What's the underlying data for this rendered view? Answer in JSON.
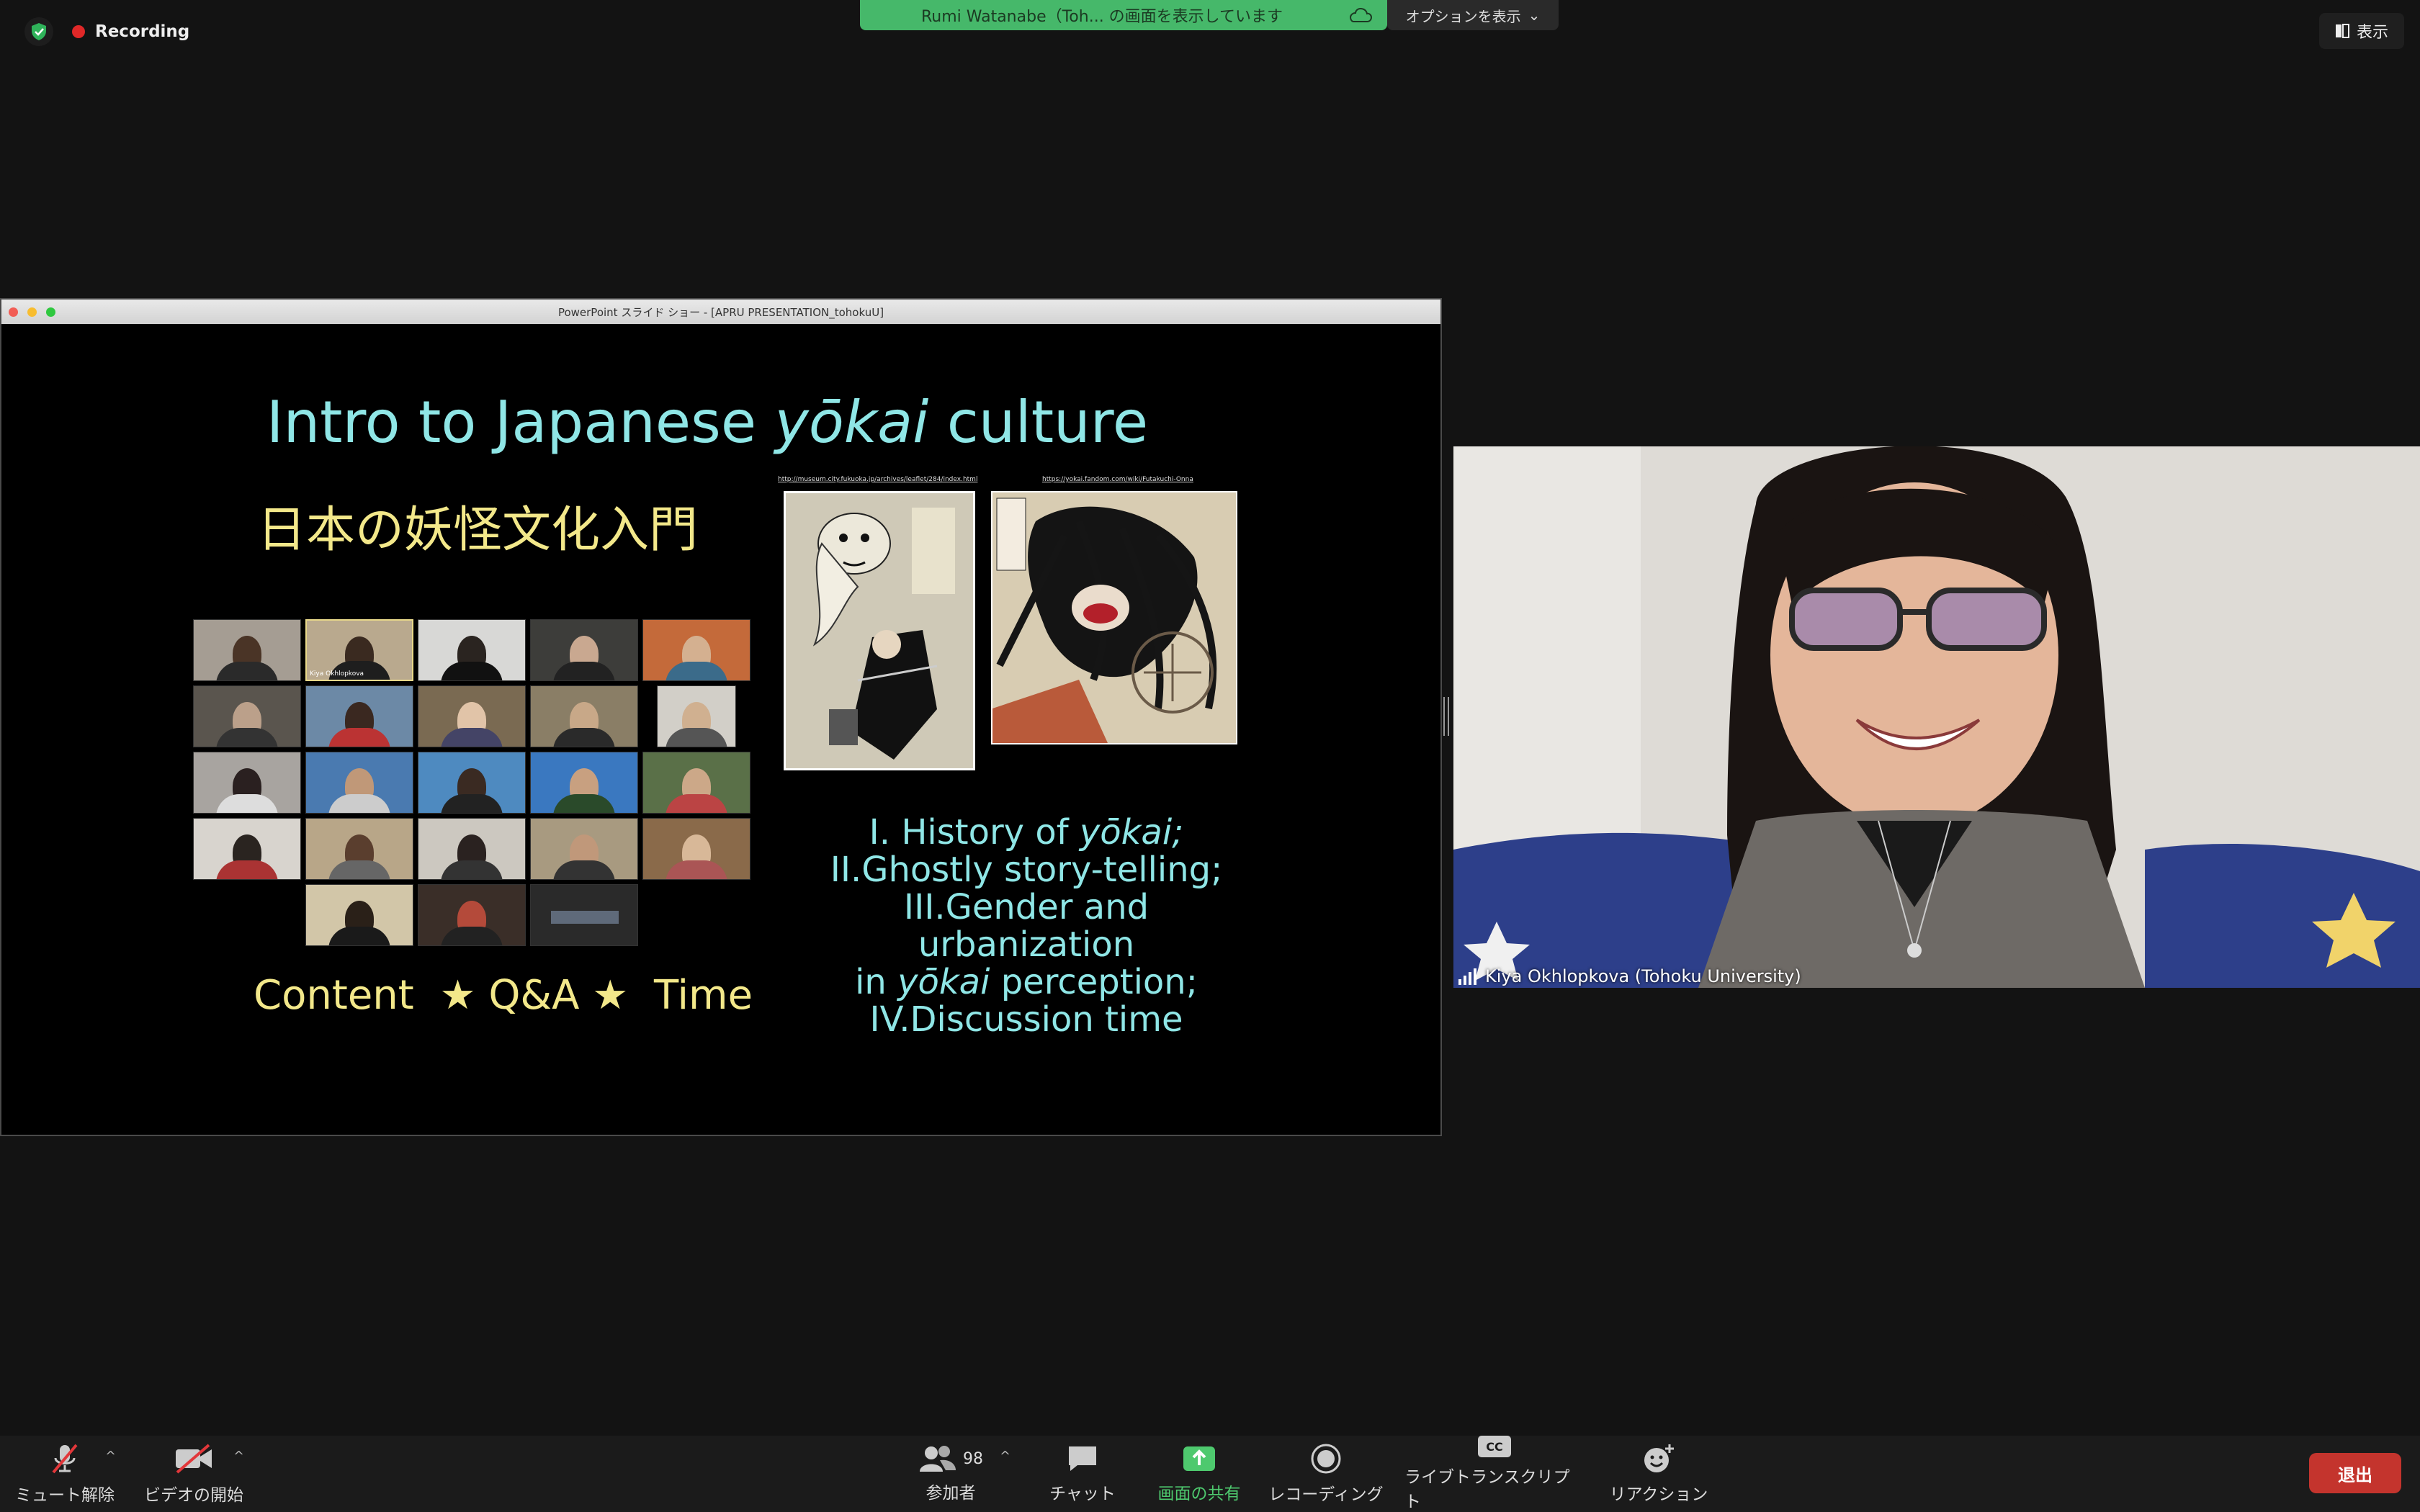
{
  "topbar": {
    "recording_label": "Recording",
    "share_banner": "Rumi Watanabe（Toh... の画面を表示しています",
    "options_label": "オプションを表示",
    "view_label": "表示"
  },
  "shared_window": {
    "title": "PowerPoint スライド ショー - [APRU PRESENTATION_tohokuU]"
  },
  "slide": {
    "title_pre": "Intro to Japanese ",
    "title_em": "yōkai",
    "title_post": " culture",
    "subtitle_jp": "日本の妖怪文化入門",
    "footer": "Content  ★ Q&A ★  Time",
    "link1": "http://museum.city.fukuoka.jp/archives/leaflet/284/index.html",
    "link2": "https://yokai.fandom.com/wiki/Futakuchi-Onna",
    "gallery_tag": "Kiya Okhlopkova",
    "agenda": {
      "l1_pre": "I.  History of ",
      "l1_em": "yōkai;",
      "l2": "II.Ghostly story-telling;",
      "l3": "III.Gender and urbanization",
      "l4_pre": "in ",
      "l4_em": "yōkai",
      "l4_post": " perception;",
      "l5": "IV.Discussion time"
    }
  },
  "speaker": {
    "name": "Kiya Okhlopkova (Tohoku University)"
  },
  "toolbar": {
    "mute_label": "ミュート解除",
    "video_label": "ビデオの開始",
    "participants_label": "参加者",
    "participants_count": "98",
    "chat_label": "チャット",
    "share_label": "画面の共有",
    "record_label": "レコーディング",
    "transcript_label": "ライブトランスクリプト",
    "cc_icon_text": "CC",
    "reaction_label": "リアクション",
    "leave_label": "退出"
  },
  "colors": {
    "share_green": "#46b86a",
    "leave_red": "#c4342d",
    "slide_cyan": "#8fe6e6",
    "slide_yellow": "#f3e88a",
    "recording_red": "#e02828"
  }
}
